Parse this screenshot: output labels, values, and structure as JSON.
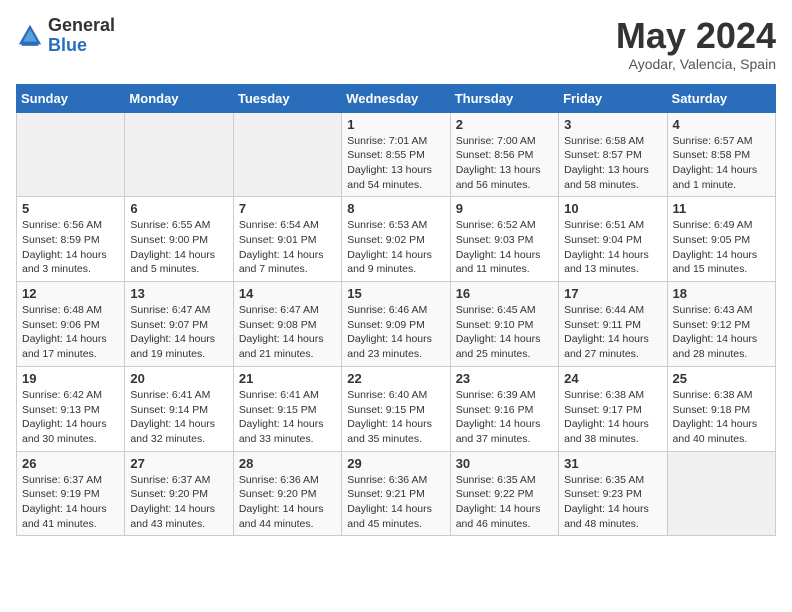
{
  "logo": {
    "general": "General",
    "blue": "Blue"
  },
  "title": "May 2024",
  "subtitle": "Ayodar, Valencia, Spain",
  "days_of_week": [
    "Sunday",
    "Monday",
    "Tuesday",
    "Wednesday",
    "Thursday",
    "Friday",
    "Saturday"
  ],
  "weeks": [
    [
      {
        "day": "",
        "info": ""
      },
      {
        "day": "",
        "info": ""
      },
      {
        "day": "",
        "info": ""
      },
      {
        "day": "1",
        "info": "Sunrise: 7:01 AM\nSunset: 8:55 PM\nDaylight: 13 hours and 54 minutes."
      },
      {
        "day": "2",
        "info": "Sunrise: 7:00 AM\nSunset: 8:56 PM\nDaylight: 13 hours and 56 minutes."
      },
      {
        "day": "3",
        "info": "Sunrise: 6:58 AM\nSunset: 8:57 PM\nDaylight: 13 hours and 58 minutes."
      },
      {
        "day": "4",
        "info": "Sunrise: 6:57 AM\nSunset: 8:58 PM\nDaylight: 14 hours and 1 minute."
      }
    ],
    [
      {
        "day": "5",
        "info": "Sunrise: 6:56 AM\nSunset: 8:59 PM\nDaylight: 14 hours and 3 minutes."
      },
      {
        "day": "6",
        "info": "Sunrise: 6:55 AM\nSunset: 9:00 PM\nDaylight: 14 hours and 5 minutes."
      },
      {
        "day": "7",
        "info": "Sunrise: 6:54 AM\nSunset: 9:01 PM\nDaylight: 14 hours and 7 minutes."
      },
      {
        "day": "8",
        "info": "Sunrise: 6:53 AM\nSunset: 9:02 PM\nDaylight: 14 hours and 9 minutes."
      },
      {
        "day": "9",
        "info": "Sunrise: 6:52 AM\nSunset: 9:03 PM\nDaylight: 14 hours and 11 minutes."
      },
      {
        "day": "10",
        "info": "Sunrise: 6:51 AM\nSunset: 9:04 PM\nDaylight: 14 hours and 13 minutes."
      },
      {
        "day": "11",
        "info": "Sunrise: 6:49 AM\nSunset: 9:05 PM\nDaylight: 14 hours and 15 minutes."
      }
    ],
    [
      {
        "day": "12",
        "info": "Sunrise: 6:48 AM\nSunset: 9:06 PM\nDaylight: 14 hours and 17 minutes."
      },
      {
        "day": "13",
        "info": "Sunrise: 6:47 AM\nSunset: 9:07 PM\nDaylight: 14 hours and 19 minutes."
      },
      {
        "day": "14",
        "info": "Sunrise: 6:47 AM\nSunset: 9:08 PM\nDaylight: 14 hours and 21 minutes."
      },
      {
        "day": "15",
        "info": "Sunrise: 6:46 AM\nSunset: 9:09 PM\nDaylight: 14 hours and 23 minutes."
      },
      {
        "day": "16",
        "info": "Sunrise: 6:45 AM\nSunset: 9:10 PM\nDaylight: 14 hours and 25 minutes."
      },
      {
        "day": "17",
        "info": "Sunrise: 6:44 AM\nSunset: 9:11 PM\nDaylight: 14 hours and 27 minutes."
      },
      {
        "day": "18",
        "info": "Sunrise: 6:43 AM\nSunset: 9:12 PM\nDaylight: 14 hours and 28 minutes."
      }
    ],
    [
      {
        "day": "19",
        "info": "Sunrise: 6:42 AM\nSunset: 9:13 PM\nDaylight: 14 hours and 30 minutes."
      },
      {
        "day": "20",
        "info": "Sunrise: 6:41 AM\nSunset: 9:14 PM\nDaylight: 14 hours and 32 minutes."
      },
      {
        "day": "21",
        "info": "Sunrise: 6:41 AM\nSunset: 9:15 PM\nDaylight: 14 hours and 33 minutes."
      },
      {
        "day": "22",
        "info": "Sunrise: 6:40 AM\nSunset: 9:15 PM\nDaylight: 14 hours and 35 minutes."
      },
      {
        "day": "23",
        "info": "Sunrise: 6:39 AM\nSunset: 9:16 PM\nDaylight: 14 hours and 37 minutes."
      },
      {
        "day": "24",
        "info": "Sunrise: 6:38 AM\nSunset: 9:17 PM\nDaylight: 14 hours and 38 minutes."
      },
      {
        "day": "25",
        "info": "Sunrise: 6:38 AM\nSunset: 9:18 PM\nDaylight: 14 hours and 40 minutes."
      }
    ],
    [
      {
        "day": "26",
        "info": "Sunrise: 6:37 AM\nSunset: 9:19 PM\nDaylight: 14 hours and 41 minutes."
      },
      {
        "day": "27",
        "info": "Sunrise: 6:37 AM\nSunset: 9:20 PM\nDaylight: 14 hours and 43 minutes."
      },
      {
        "day": "28",
        "info": "Sunrise: 6:36 AM\nSunset: 9:20 PM\nDaylight: 14 hours and 44 minutes."
      },
      {
        "day": "29",
        "info": "Sunrise: 6:36 AM\nSunset: 9:21 PM\nDaylight: 14 hours and 45 minutes."
      },
      {
        "day": "30",
        "info": "Sunrise: 6:35 AM\nSunset: 9:22 PM\nDaylight: 14 hours and 46 minutes."
      },
      {
        "day": "31",
        "info": "Sunrise: 6:35 AM\nSunset: 9:23 PM\nDaylight: 14 hours and 48 minutes."
      },
      {
        "day": "",
        "info": ""
      }
    ]
  ]
}
